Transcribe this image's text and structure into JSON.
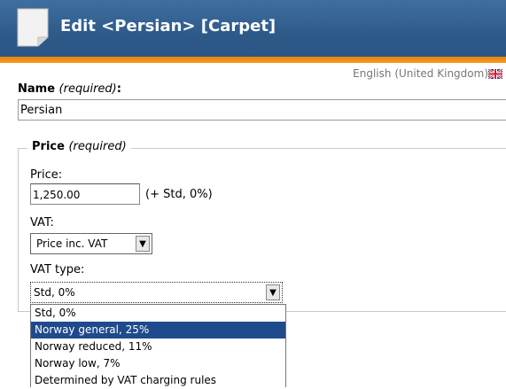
{
  "header": {
    "title": "Edit <Persian> [Carpet]"
  },
  "language": {
    "label": "English (United Kingdom)",
    "flag_icon": "uk-flag-icon"
  },
  "name_field": {
    "label": "Name",
    "required_note": "(required)",
    "colon": ":",
    "value": "Persian"
  },
  "price_group": {
    "legend": "Price",
    "required_note": "(required)",
    "price_label": "Price:",
    "price_value": "1,250.00",
    "price_note": "(+ Std, 0%)",
    "vat_label": "VAT:",
    "vat_selected": "Price inc. VAT",
    "vat_type_label": "VAT type:",
    "vat_type_selected": "Std, 0%"
  },
  "vat_type_options": [
    {
      "label": "Std, 0%"
    },
    {
      "label": "Norway general, 25%"
    },
    {
      "label": "Norway reduced, 11%"
    },
    {
      "label": "Norway low, 7%"
    },
    {
      "label": "Determined by VAT charging rules"
    }
  ],
  "colors": {
    "header_blue": "#2e5a8a",
    "accent_orange": "#e8820c",
    "highlight": "#1f4a8c"
  }
}
